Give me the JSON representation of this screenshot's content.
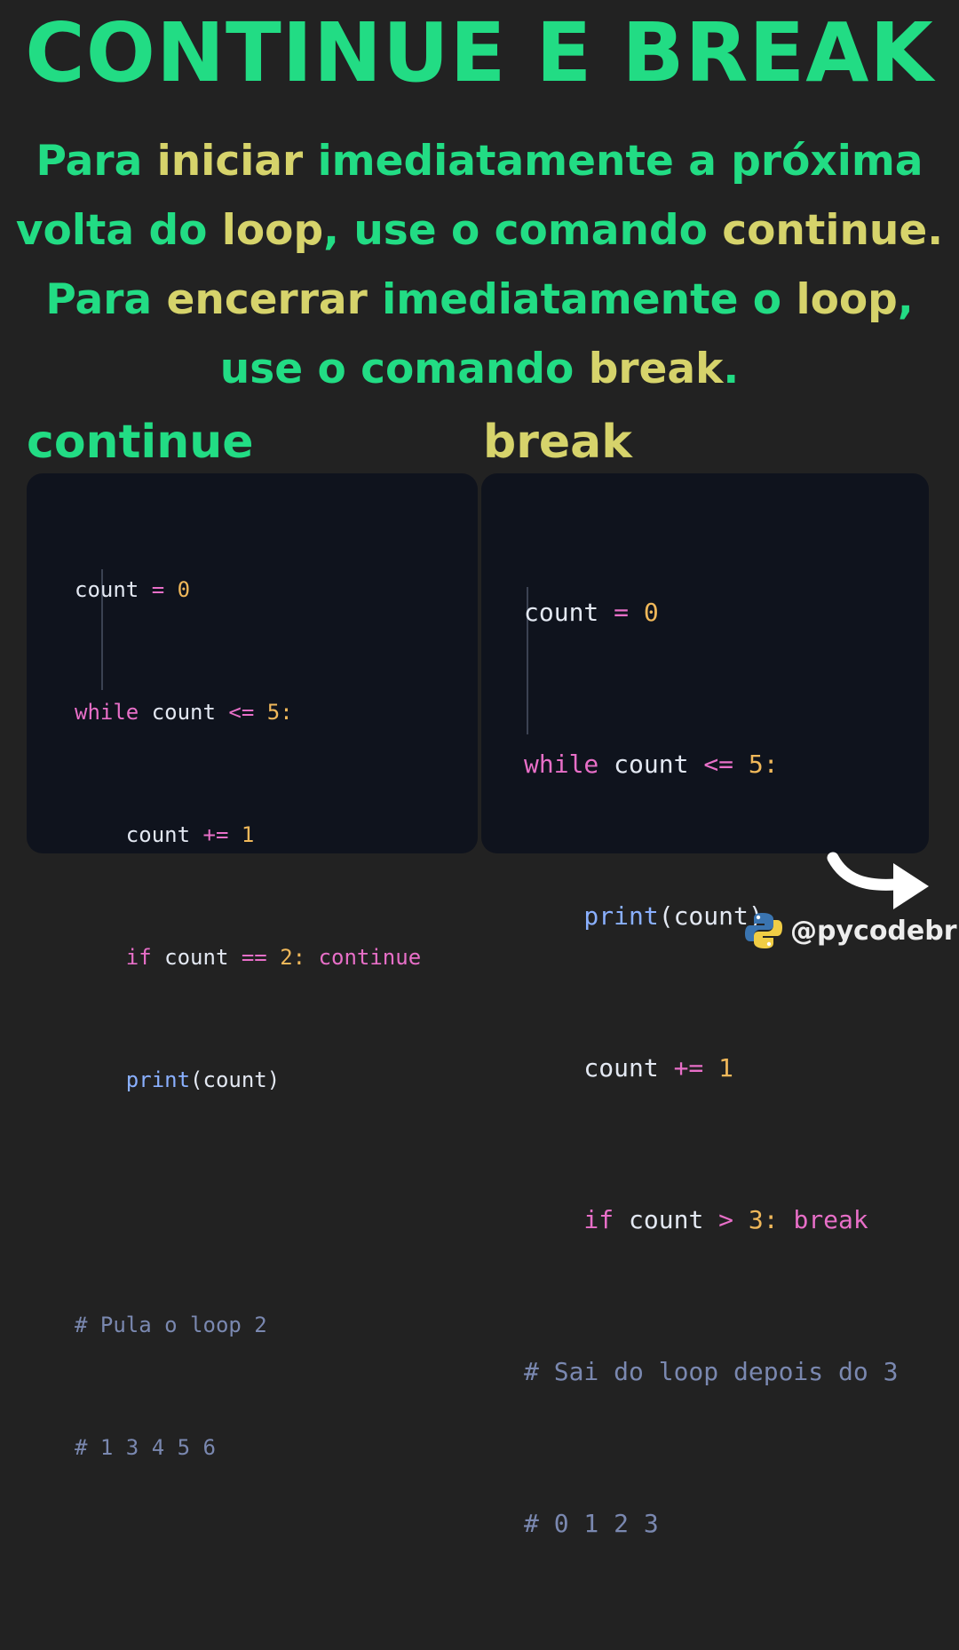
{
  "title": "CONTINUE E BREAK",
  "intro": {
    "l1a": "Para ",
    "l1b": "iniciar",
    "l1c": " imediatamente a próxima",
    "l2a": "volta do ",
    "l2b": "loop",
    "l2c": ", use o comando ",
    "l2d": "continue.",
    "l3a": "Para ",
    "l3b": "encerrar",
    "l3c": " imediatamente o ",
    "l3d": "loop",
    "l3e": ",",
    "l4a": "use o comando ",
    "l4b": "break",
    "l4c": "."
  },
  "sections": {
    "continue_label": "continue",
    "break_label": "break"
  },
  "code_continue": {
    "l1": [
      "count",
      " = ",
      "0"
    ],
    "l2": [
      "while",
      " count ",
      "<=",
      " 5:"
    ],
    "l3": [
      "    count ",
      "+=",
      " 1"
    ],
    "l4": [
      "    if",
      " count ",
      "==",
      " 2: ",
      "continue"
    ],
    "l5": [
      "    print",
      "(count)"
    ],
    "c1": "# Pula o loop 2",
    "c2": "# 1 3 4 5 6"
  },
  "code_break": {
    "l1": [
      "count",
      " = ",
      "0"
    ],
    "l2": [
      "while",
      " count ",
      "<=",
      " 5:"
    ],
    "l3": [
      "    print",
      "(count)"
    ],
    "l4": [
      "    count ",
      "+=",
      " 1"
    ],
    "l5": [
      "    if",
      " count ",
      ">",
      " 3: ",
      "break"
    ],
    "c1": "# Sai do loop depois do 3",
    "c2": "# 0 1 2 3"
  },
  "footer": {
    "handle": "@pycodebr",
    "arrow_icon": "curved-arrow-right-icon",
    "logo_icon": "python-logo-icon"
  },
  "colors": {
    "background": "#222222",
    "green": "#22dc84",
    "yellow": "#d6d36b",
    "panel": "#0f131d",
    "keyword": "#e86fc8",
    "number": "#f0b85a",
    "function": "#8ab0ff",
    "comment": "#7a88b0"
  }
}
